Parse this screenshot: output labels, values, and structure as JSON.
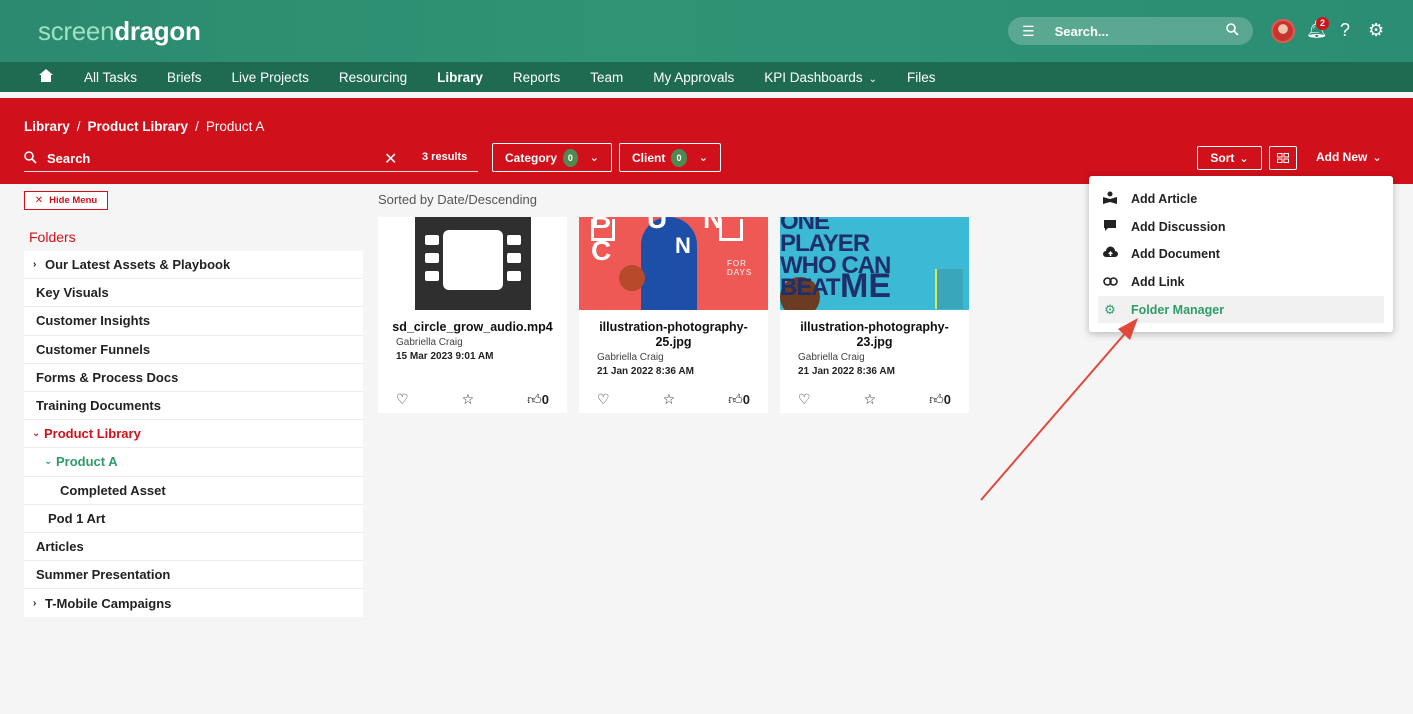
{
  "header": {
    "logo_part1": "screen",
    "logo_part2": "dragon",
    "search_placeholder": "Search...",
    "notification_count": "2",
    "icons": [
      "hamburger-icon",
      "search-icon",
      "bell-icon",
      "help-icon",
      "gear-icon"
    ]
  },
  "nav": {
    "items": [
      "All Tasks",
      "Briefs",
      "Live Projects",
      "Resourcing",
      "Library",
      "Reports",
      "Team",
      "My Approvals",
      "KPI Dashboards",
      "Files"
    ],
    "active": "Library"
  },
  "breadcrumb": {
    "items": [
      "Library",
      "Product Library",
      "Product A"
    ]
  },
  "toolbar": {
    "search_label": "Search",
    "results": "3 results",
    "category_label": "Category",
    "category_count": "0",
    "client_label": "Client",
    "client_count": "0",
    "sort_label": "Sort",
    "add_new_label": "Add New"
  },
  "sidebar": {
    "hide_menu_label": "Hide Menu",
    "folders_title": "Folders",
    "folders": [
      {
        "label": "Our Latest Assets & Playbook"
      },
      {
        "label": "Key Visuals"
      },
      {
        "label": "Customer Insights"
      },
      {
        "label": "Customer Funnels"
      },
      {
        "label": "Forms & Process Docs"
      },
      {
        "label": "Training Documents"
      },
      {
        "label": "Product Library"
      },
      {
        "label": "Product A"
      },
      {
        "label": "Completed Asset"
      },
      {
        "label": "Pod 1 Art"
      },
      {
        "label": "Articles"
      },
      {
        "label": "Summer Presentation"
      },
      {
        "label": "T-Mobile Campaigns"
      }
    ]
  },
  "main": {
    "sorted_label": "Sorted by Date/Descending",
    "cards": [
      {
        "name": "sd_circle_grow_audio.mp4",
        "author": "Gabriella Craig",
        "date": "15 Mar 2023 9:01 AM",
        "likes": "0"
      },
      {
        "name": "illustration-photography-25.jpg",
        "author": "Gabriella Craig",
        "date": "21 Jan 2022 8:36 AM",
        "likes": "0",
        "thumb_text": "B   U   N   C",
        "thumb_sub": "FOR DAYS"
      },
      {
        "name": "illustration-photography-23.jpg",
        "author": "Gabriella Craig",
        "date": "21 Jan 2022 8:36 AM",
        "likes": "0",
        "thumb_text": "ONE PLAYER WHO CAN BEAT",
        "thumb_sub": "ME"
      }
    ]
  },
  "dropdown": {
    "items": [
      {
        "label": "Add Article",
        "icon": "article-icon"
      },
      {
        "label": "Add Discussion",
        "icon": "discussion-icon"
      },
      {
        "label": "Add Document",
        "icon": "upload-cloud-icon"
      },
      {
        "label": "Add Link",
        "icon": "link-icon"
      },
      {
        "label": "Folder Manager",
        "icon": "gear-icon"
      }
    ],
    "highlight_color": "#2e9c6a"
  },
  "colors": {
    "brand_green": "#2c8a6e",
    "nav_green": "#1f6b52",
    "accent_red": "#d0101a"
  }
}
